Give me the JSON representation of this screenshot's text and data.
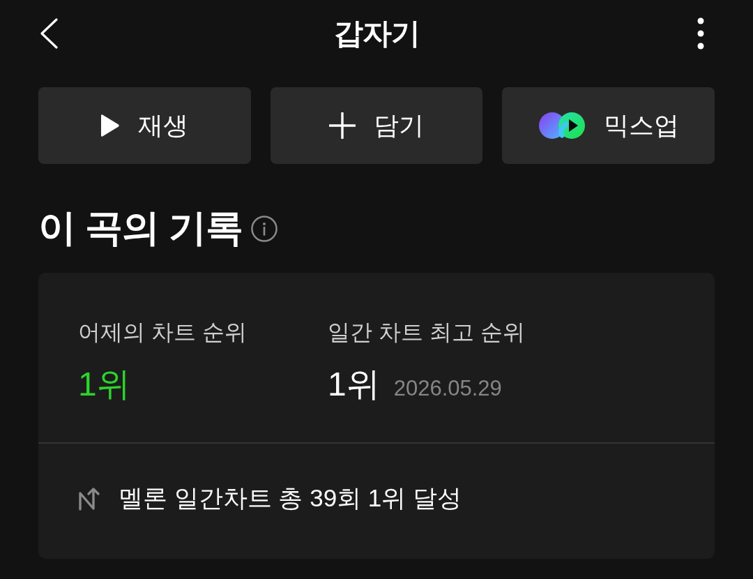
{
  "header": {
    "title": "갑자기"
  },
  "actions": [
    {
      "kind": "play",
      "label": "재생"
    },
    {
      "kind": "add",
      "label": "담기"
    },
    {
      "kind": "mixup",
      "label": "믹스업"
    }
  ],
  "section": {
    "title": "이 곡의 기록"
  },
  "record": {
    "stats": [
      {
        "label": "어제의 차트 순위",
        "value": "1위",
        "highlight": true
      },
      {
        "label": "일간 차트 최고 순위",
        "value": "1위",
        "date": "2026.05.29",
        "highlight": false
      }
    ],
    "achievement": "멜론 일간차트 총 39회 1위 달성"
  }
}
